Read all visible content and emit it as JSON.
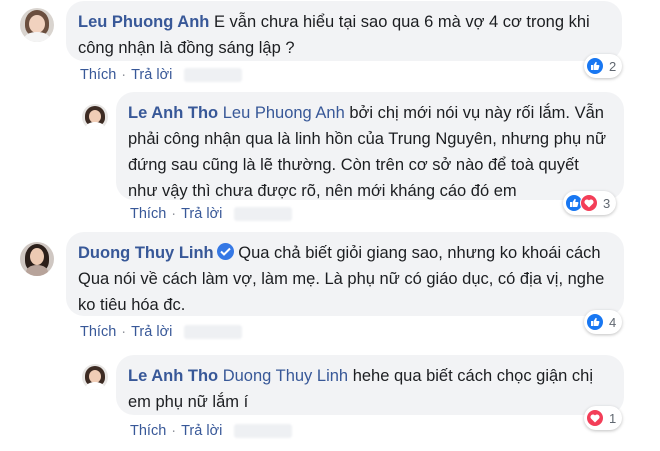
{
  "comments": [
    {
      "name": "Leu Phuong Anh",
      "mention": "",
      "text": "E vẫn chưa hiểu tại sao qua 6 mà vợ 4 cơ trong khi công nhận là đồng sáng lập ?",
      "like_label": "Thích",
      "reply_label": "Trả lời",
      "reaction_count": "2",
      "reactions": [
        "like-icon"
      ]
    },
    {
      "name": "Le Anh Tho",
      "mention": "Leu Phuong Anh",
      "text": "bởi chị mới nói vụ này rối lắm. Vẫn phải công nhận qua là linh hồn của Trung Nguyên, nhưng phụ nữ đứng sau cũng là lẽ thường. Còn trên cơ sở nào để toà quyết như vậy thì chưa được rõ, nên mới kháng cáo đó em",
      "like_label": "Thích",
      "reply_label": "Trả lời",
      "reaction_count": "3",
      "reactions": [
        "like-icon",
        "love-icon"
      ]
    },
    {
      "name": "Duong Thuy Linh",
      "mention": "",
      "text": "Qua chả biết giỏi giang sao, nhưng ko khoái cách Qua nói về cách làm vợ, làm mẹ. Là phụ nữ có giáo dục, có địa vị, nghe ko tiêu hóa đc.",
      "like_label": "Thích",
      "reply_label": "Trả lời",
      "reaction_count": "4",
      "reactions": [
        "like-icon"
      ]
    },
    {
      "name": "Le Anh Tho",
      "mention": "Duong Thuy Linh",
      "text": "hehe qua biết cách chọc giận chị em phụ nữ lắm í",
      "like_label": "Thích",
      "reply_label": "Trả lời",
      "reaction_count": "1",
      "reactions": [
        "love-icon"
      ]
    }
  ],
  "colors": {
    "link": "#385898",
    "bubble": "#f2f3f5",
    "like": "#1877f2",
    "love": "#f33e58",
    "verified": "#3578e5"
  }
}
